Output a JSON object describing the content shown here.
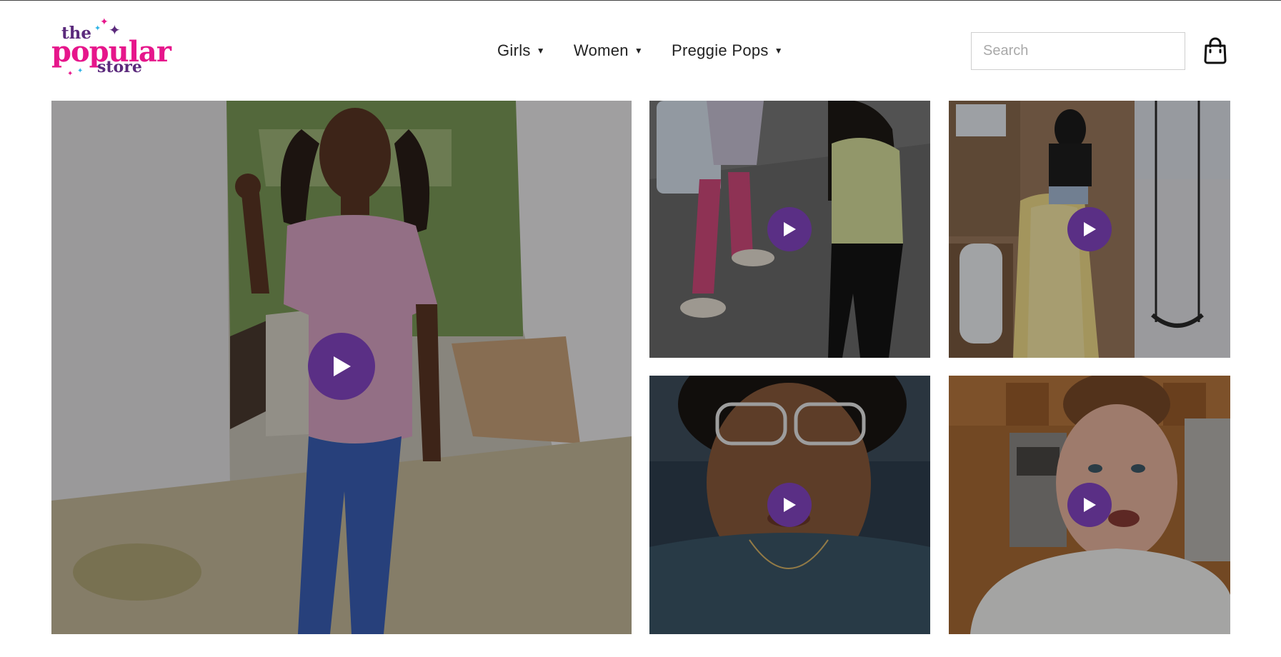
{
  "brand": {
    "logo_the": "the",
    "logo_popular": "popular",
    "logo_store": "store",
    "colors": {
      "pink": "#e6168b",
      "purple": "#5b2a7c",
      "play_button": "#5a2f85"
    }
  },
  "nav": {
    "items": [
      {
        "label": "Girls",
        "icon": "caret-down-icon"
      },
      {
        "label": "Women",
        "icon": "caret-down-icon"
      },
      {
        "label": "Preggie Pops",
        "icon": "caret-down-icon"
      }
    ]
  },
  "search": {
    "placeholder": "Search",
    "value": ""
  },
  "cart": {
    "icon": "shopping-bag-icon"
  },
  "gallery": {
    "videos": [
      {
        "subject": "girl in pink tee and blue leggings",
        "icon": "play-icon"
      },
      {
        "subject": "two kids walking on pavement",
        "icon": "play-icon"
      },
      {
        "subject": "child on yellow slide",
        "icon": "play-icon"
      },
      {
        "subject": "woman with clear glasses",
        "icon": "play-icon"
      },
      {
        "subject": "woman in kitchen",
        "icon": "play-icon"
      }
    ]
  }
}
